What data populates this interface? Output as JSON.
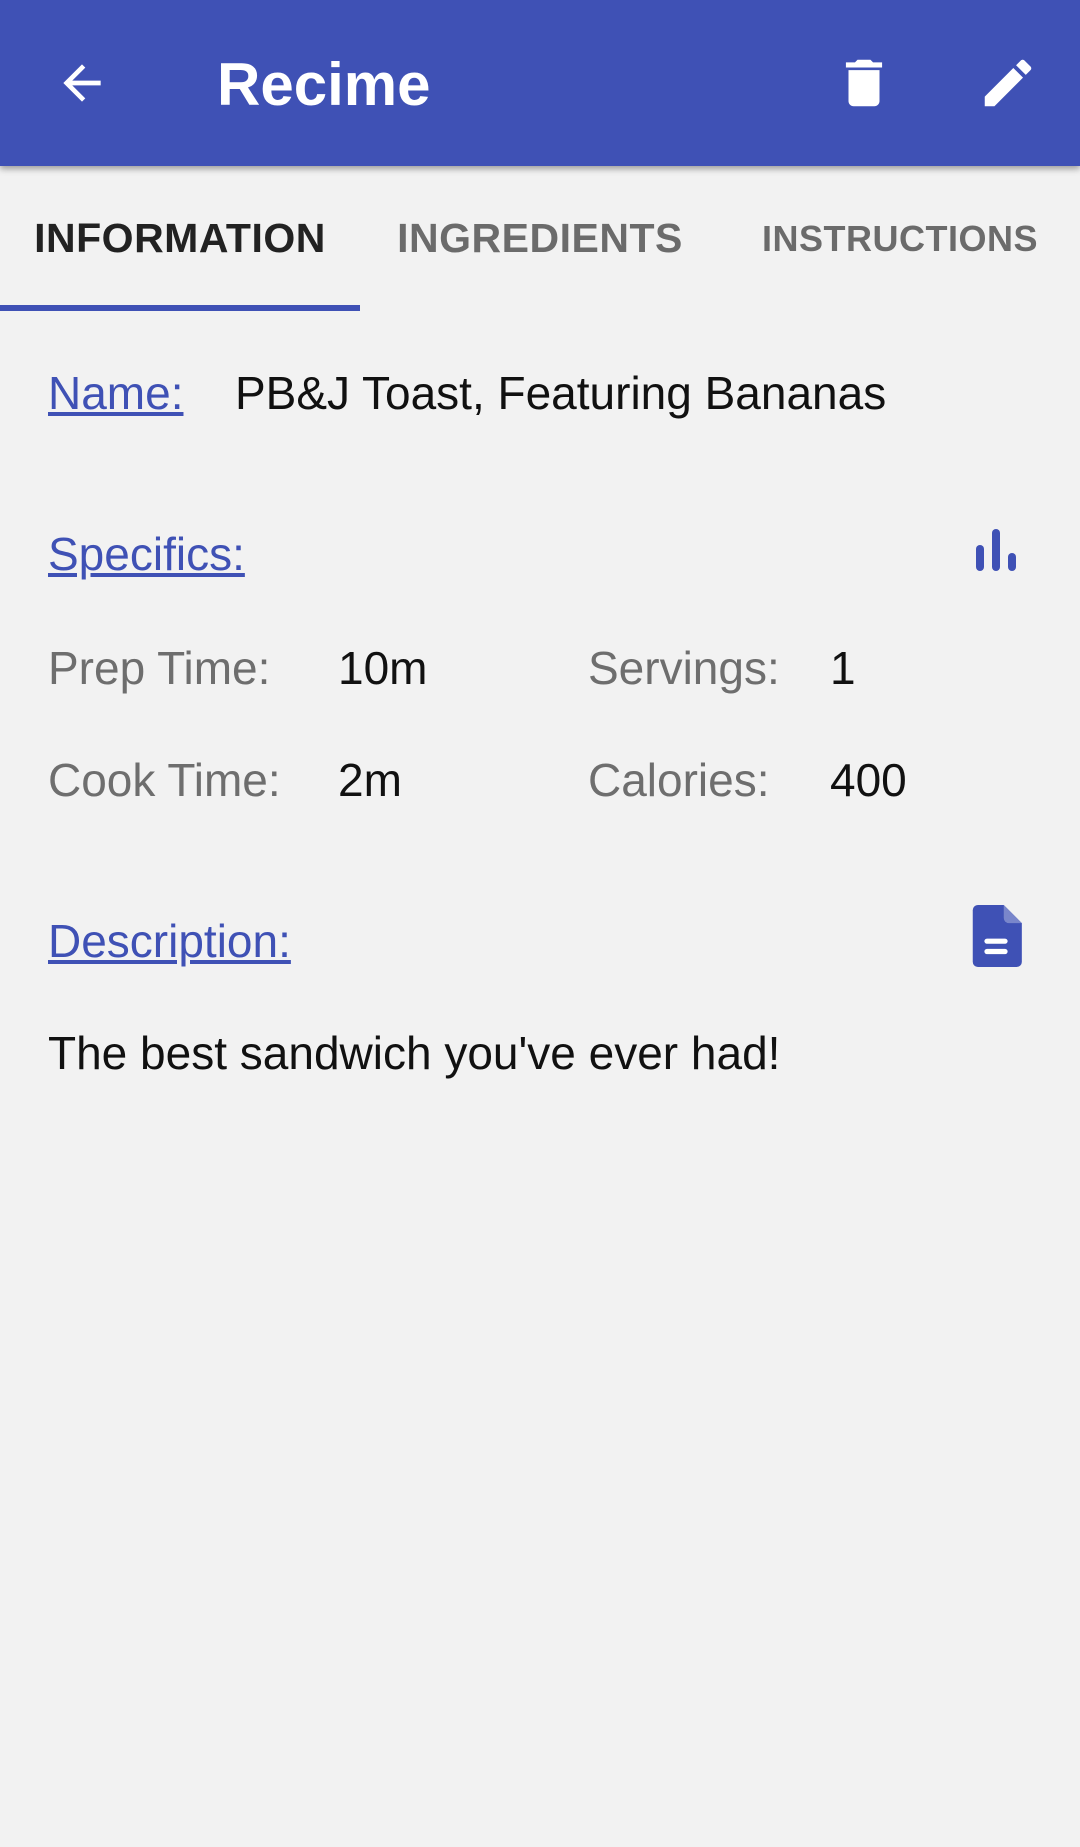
{
  "app_bar": {
    "title": "Recime",
    "icons": {
      "back": "arrow-back-icon",
      "delete": "trash-icon",
      "edit": "pencil-icon"
    },
    "background_color": "#3f51b5"
  },
  "tabs": [
    {
      "label": "INFORMATION",
      "selected": true
    },
    {
      "label": "INGREDIENTS",
      "selected": false
    },
    {
      "label": "INSTRUCTIONS",
      "selected": false
    }
  ],
  "information": {
    "name_label": "Name:",
    "name_value": "PB&J Toast, Featuring Bananas",
    "specifics_label": "Specifics:",
    "specifics_icon": "bar-chart-icon",
    "prep_time_label": "Prep Time:",
    "prep_time_value": "10m",
    "servings_label": "Servings:",
    "servings_value": "1",
    "cook_time_label": "Cook Time:",
    "cook_time_value": "2m",
    "calories_label": "Calories:",
    "calories_value": "400",
    "description_label": "Description:",
    "description_icon": "document-icon",
    "description_value": "The best sandwich you've ever had!"
  },
  "colors": {
    "accent": "#3f51b5",
    "background": "#f2f2f2"
  }
}
